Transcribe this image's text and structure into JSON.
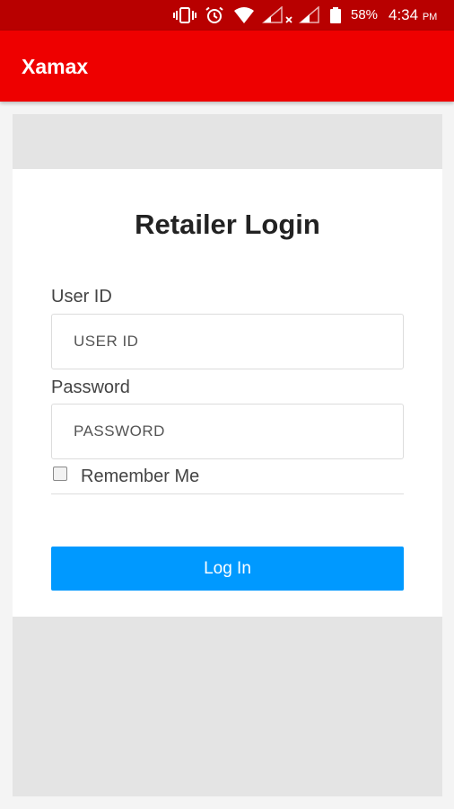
{
  "status_bar": {
    "battery": "58%",
    "time": "4:34",
    "ampm": "PM",
    "icons": [
      "vibrate-icon",
      "alarm-icon",
      "wifi-icon",
      "signal-no-data-icon",
      "signal-icon",
      "battery-icon"
    ]
  },
  "app_bar": {
    "title": "Xamax",
    "color": "#ee0000"
  },
  "login": {
    "title": "Retailer Login",
    "user_id_label": "User ID",
    "user_id_placeholder": "USER ID",
    "password_label": "Password",
    "password_placeholder": "PASSWORD",
    "remember_label": "Remember Me",
    "remember_checked": false,
    "button_label": "Log In",
    "button_color": "#0099ff"
  }
}
